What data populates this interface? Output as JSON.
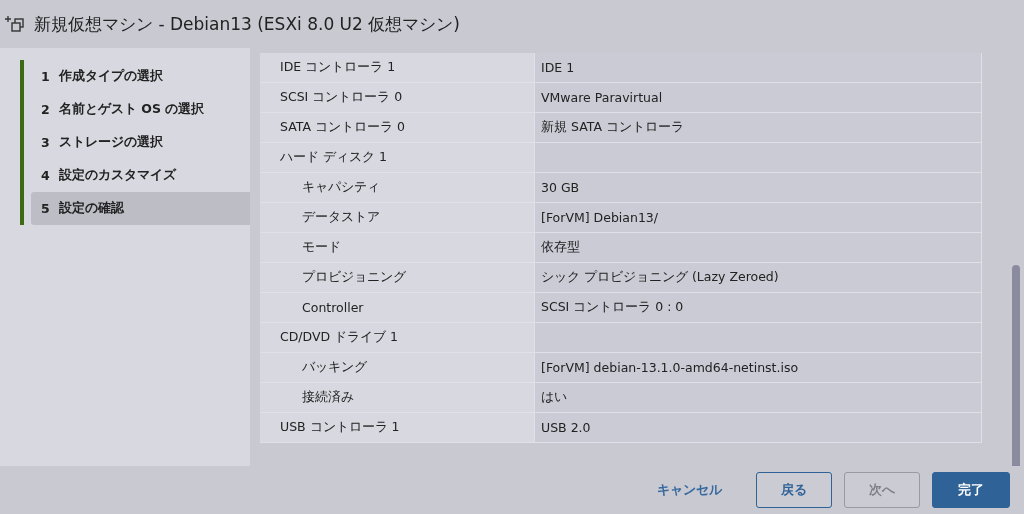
{
  "window": {
    "title": "新規仮想マシン - Debian13 (ESXi 8.0 U2 仮想マシン)"
  },
  "steps": [
    {
      "number": "1",
      "label": "作成タイプの選択",
      "selected": false
    },
    {
      "number": "2",
      "label": "名前とゲスト OS の選択",
      "selected": false
    },
    {
      "number": "3",
      "label": "ストレージの選択",
      "selected": false
    },
    {
      "number": "4",
      "label": "設定のカスタマイズ",
      "selected": false
    },
    {
      "number": "5",
      "label": "設定の確認",
      "selected": true
    }
  ],
  "settings": [
    {
      "label": "IDE コントローラ 1",
      "value": "IDE 1"
    },
    {
      "label": "SCSI コントローラ 0",
      "value": "VMware Paravirtual"
    },
    {
      "label": "SATA コントローラ 0",
      "value": "新規 SATA コントローラ"
    },
    {
      "label": "ハード ディスク 1",
      "children": [
        {
          "label": "キャパシティ",
          "value": "30 GB"
        },
        {
          "label": "データストア",
          "value": "[ForVM] Debian13/"
        },
        {
          "label": "モード",
          "value": "依存型"
        },
        {
          "label": "プロビジョニング",
          "value": "シック プロビジョニング (Lazy Zeroed)"
        },
        {
          "label": "Controller",
          "value": "SCSI コントローラ 0 : 0"
        }
      ]
    },
    {
      "label": "CD/DVD ドライブ 1",
      "children": [
        {
          "label": "バッキング",
          "value": "[ForVM] debian-13.1.0-amd64-netinst.iso"
        },
        {
          "label": "接続済み",
          "value": "はい"
        }
      ]
    },
    {
      "label": "USB コントローラ 1",
      "value": "USB 2.0"
    }
  ],
  "buttons": [
    {
      "label": "キャンセル",
      "kind": "link",
      "disabled": false
    },
    {
      "label": "戻る",
      "kind": "outline",
      "disabled": false
    },
    {
      "label": "次へ",
      "kind": "outline",
      "disabled": true
    },
    {
      "label": "完了",
      "kind": "primary",
      "disabled": false
    }
  ]
}
